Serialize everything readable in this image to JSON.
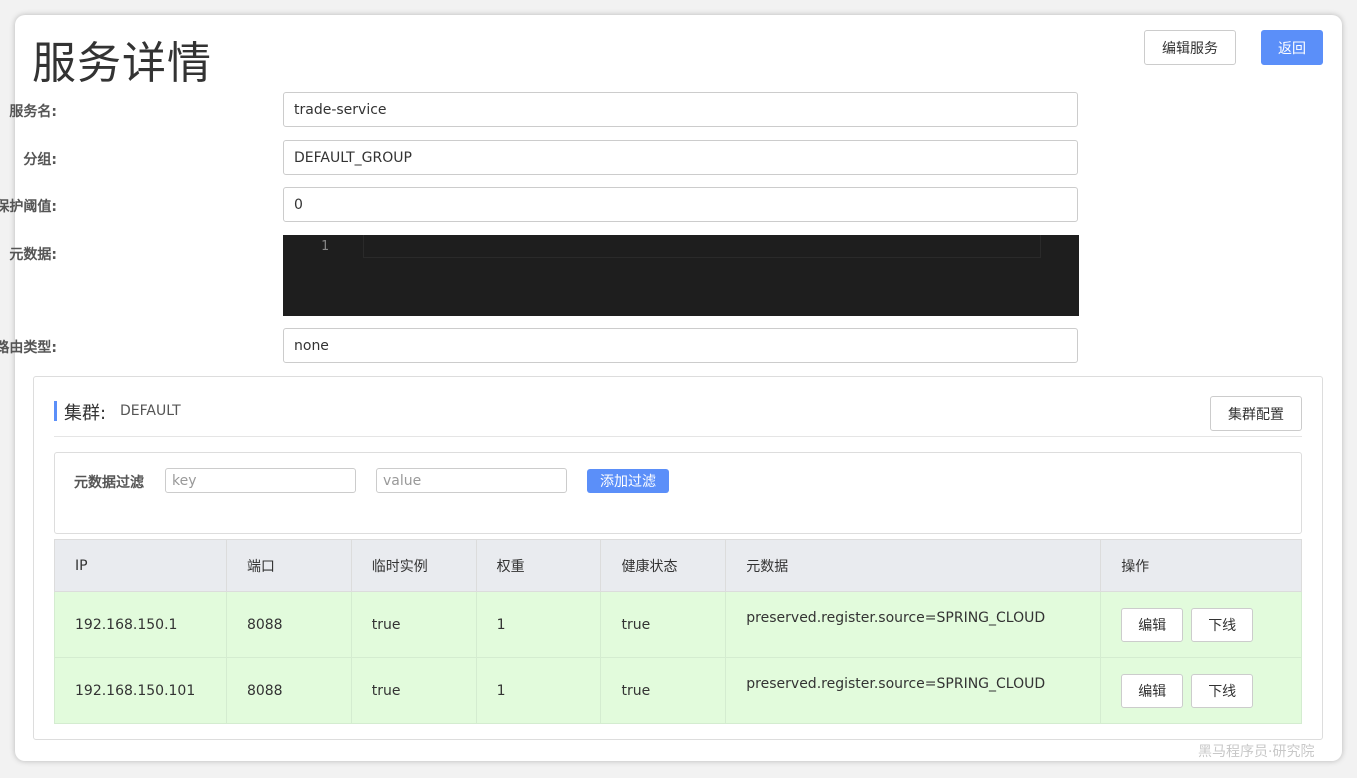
{
  "page": {
    "title": "服务详情",
    "edit_service_label": "编辑服务",
    "back_label": "返回"
  },
  "form": {
    "service_name_label": "服务名:",
    "service_name_value": "trade-service",
    "group_label": "分组:",
    "group_value": "DEFAULT_GROUP",
    "threshold_label": "保护阈值:",
    "threshold_value": "0",
    "metadata_label": "元数据:",
    "metadata_line_number": "1",
    "selector_label": "服务路由类型:",
    "selector_value": "none"
  },
  "cluster": {
    "title": "集群:",
    "name": "DEFAULT",
    "config_label": "集群配置",
    "filter": {
      "label": "元数据过滤",
      "key_placeholder": "key",
      "value_placeholder": "value",
      "add_label": "添加过滤"
    },
    "table": {
      "headers": [
        "IP",
        "端口",
        "临时实例",
        "权重",
        "健康状态",
        "元数据",
        "操作"
      ],
      "rows": [
        {
          "ip": "192.168.150.1",
          "port": "8088",
          "ephemeral": "true",
          "weight": "1",
          "healthy": "true",
          "metadata": "preserved.register.source=SPRING_CLOUD",
          "edit_label": "编辑",
          "offline_label": "下线"
        },
        {
          "ip": "192.168.150.101",
          "port": "8088",
          "ephemeral": "true",
          "weight": "1",
          "healthy": "true",
          "metadata": "preserved.register.source=SPRING_CLOUD",
          "edit_label": "编辑",
          "offline_label": "下线"
        }
      ]
    }
  },
  "watermark": "黑马程序员·研究院",
  "colors": {
    "primary": "#5b8ff9",
    "row_bg": "#e2fbdc",
    "header_bg": "#e9ebef",
    "editor_bg": "#1e1e1e"
  }
}
